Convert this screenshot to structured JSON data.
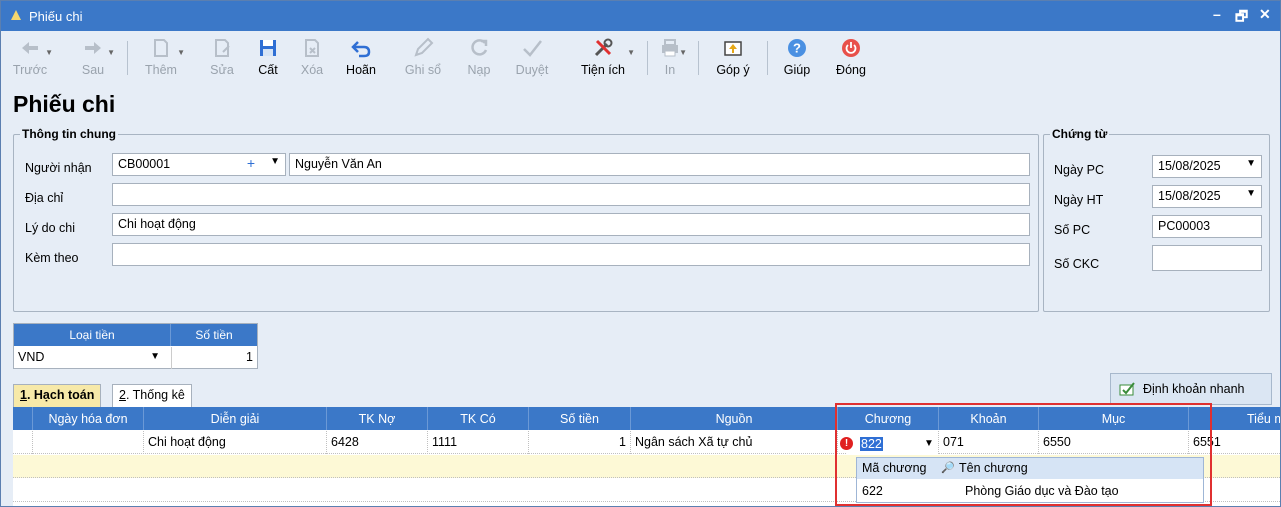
{
  "window": {
    "title": "Phiếu chi",
    "controls": [
      "–",
      "🗗",
      "✕"
    ]
  },
  "toolbar": [
    {
      "id": "truoc",
      "label": "Trước",
      "icon": "arrow-left-icon",
      "enabled": false,
      "dropdown": true
    },
    {
      "id": "sau",
      "label": "Sau",
      "icon": "arrow-right-icon",
      "enabled": false,
      "dropdown": true
    },
    {
      "id": "them",
      "label": "Thêm",
      "icon": "new-document-icon",
      "enabled": false,
      "dropdown": true
    },
    {
      "id": "sua",
      "label": "Sửa",
      "icon": "edit-document-icon",
      "enabled": false
    },
    {
      "id": "cat",
      "label": "Cất",
      "icon": "save-icon",
      "enabled": true
    },
    {
      "id": "xoa",
      "label": "Xóa",
      "icon": "delete-document-icon",
      "enabled": false
    },
    {
      "id": "hoan",
      "label": "Hoãn",
      "icon": "undo-icon",
      "enabled": true
    },
    {
      "id": "ghiso",
      "label": "Ghi sổ",
      "icon": "pencil-icon",
      "enabled": false
    },
    {
      "id": "nap",
      "label": "Nạp",
      "icon": "refresh-icon",
      "enabled": false
    },
    {
      "id": "duyet",
      "label": "Duyệt",
      "icon": "checkmark-icon",
      "enabled": false
    },
    {
      "id": "tienich",
      "label": "Tiện ích",
      "icon": "tools-icon",
      "enabled": true,
      "dropdown": true
    },
    {
      "id": "in",
      "label": "In",
      "icon": "printer-icon",
      "enabled": false,
      "dropdown": true
    },
    {
      "id": "gopy",
      "label": "Góp ý",
      "icon": "feedback-icon",
      "enabled": true
    },
    {
      "id": "giup",
      "label": "Giúp",
      "icon": "help-icon",
      "enabled": true
    },
    {
      "id": "dong",
      "label": "Đóng",
      "icon": "power-icon",
      "enabled": true
    }
  ],
  "page_title": "Phiếu chi",
  "general": {
    "legend": "Thông tin chung",
    "nguoi_nhan_label": "Người nhận",
    "nguoi_nhan_code": "CB00001",
    "nguoi_nhan_name": "Nguyễn Văn An",
    "dia_chi_label": "Địa chỉ",
    "dia_chi": "",
    "ly_do_label": "Lý do chi",
    "ly_do": "Chi hoạt động",
    "kem_theo_label": "Kèm theo",
    "kem_theo": ""
  },
  "voucher": {
    "legend": "Chứng từ",
    "ngay_pc_label": "Ngày PC",
    "ngay_pc": "15/08/2025",
    "ngay_ht_label": "Ngày HT",
    "ngay_ht": "15/08/2025",
    "so_pc_label": "Số PC",
    "so_pc": "PC00003",
    "so_ckc_label": "Số CKC",
    "so_ckc": ""
  },
  "money": {
    "loai_tien_header": "Loại tiền",
    "so_tien_header": "Số tiền",
    "loai_tien": "VND",
    "so_tien": "1"
  },
  "tabs": [
    {
      "num": "1",
      "label": ". Hạch toán"
    },
    {
      "num": "2",
      "label": ". Thống kê"
    }
  ],
  "quick_button": "Định khoản nhanh",
  "grid": {
    "columns": [
      "Ngày hóa đơn",
      "Diễn giải",
      "TK Nợ",
      "TK Có",
      "Số tiền",
      "Nguồn",
      "Chương",
      "Khoản",
      "Mục",
      "Tiểu mục"
    ],
    "rows": [
      {
        "ngay": "",
        "dien_giai": "Chi hoạt động",
        "tk_no": "6428",
        "tk_co": "1111",
        "so_tien": "1",
        "nguon": "Ngân sách Xã tự chủ",
        "chuong": "822",
        "khoan": "071",
        "muc": "6550",
        "tieu_muc": "6551"
      }
    ]
  },
  "popup": {
    "col1": "Mã chương",
    "col2": "Tên chương",
    "rows": [
      {
        "ma": "622",
        "ten": "Phòng Giáo dục và Đào tạo"
      }
    ]
  },
  "colors": {
    "header_blue": "#3b78c8",
    "active_tab": "#f7e9a8",
    "highlight": "#e03030"
  }
}
